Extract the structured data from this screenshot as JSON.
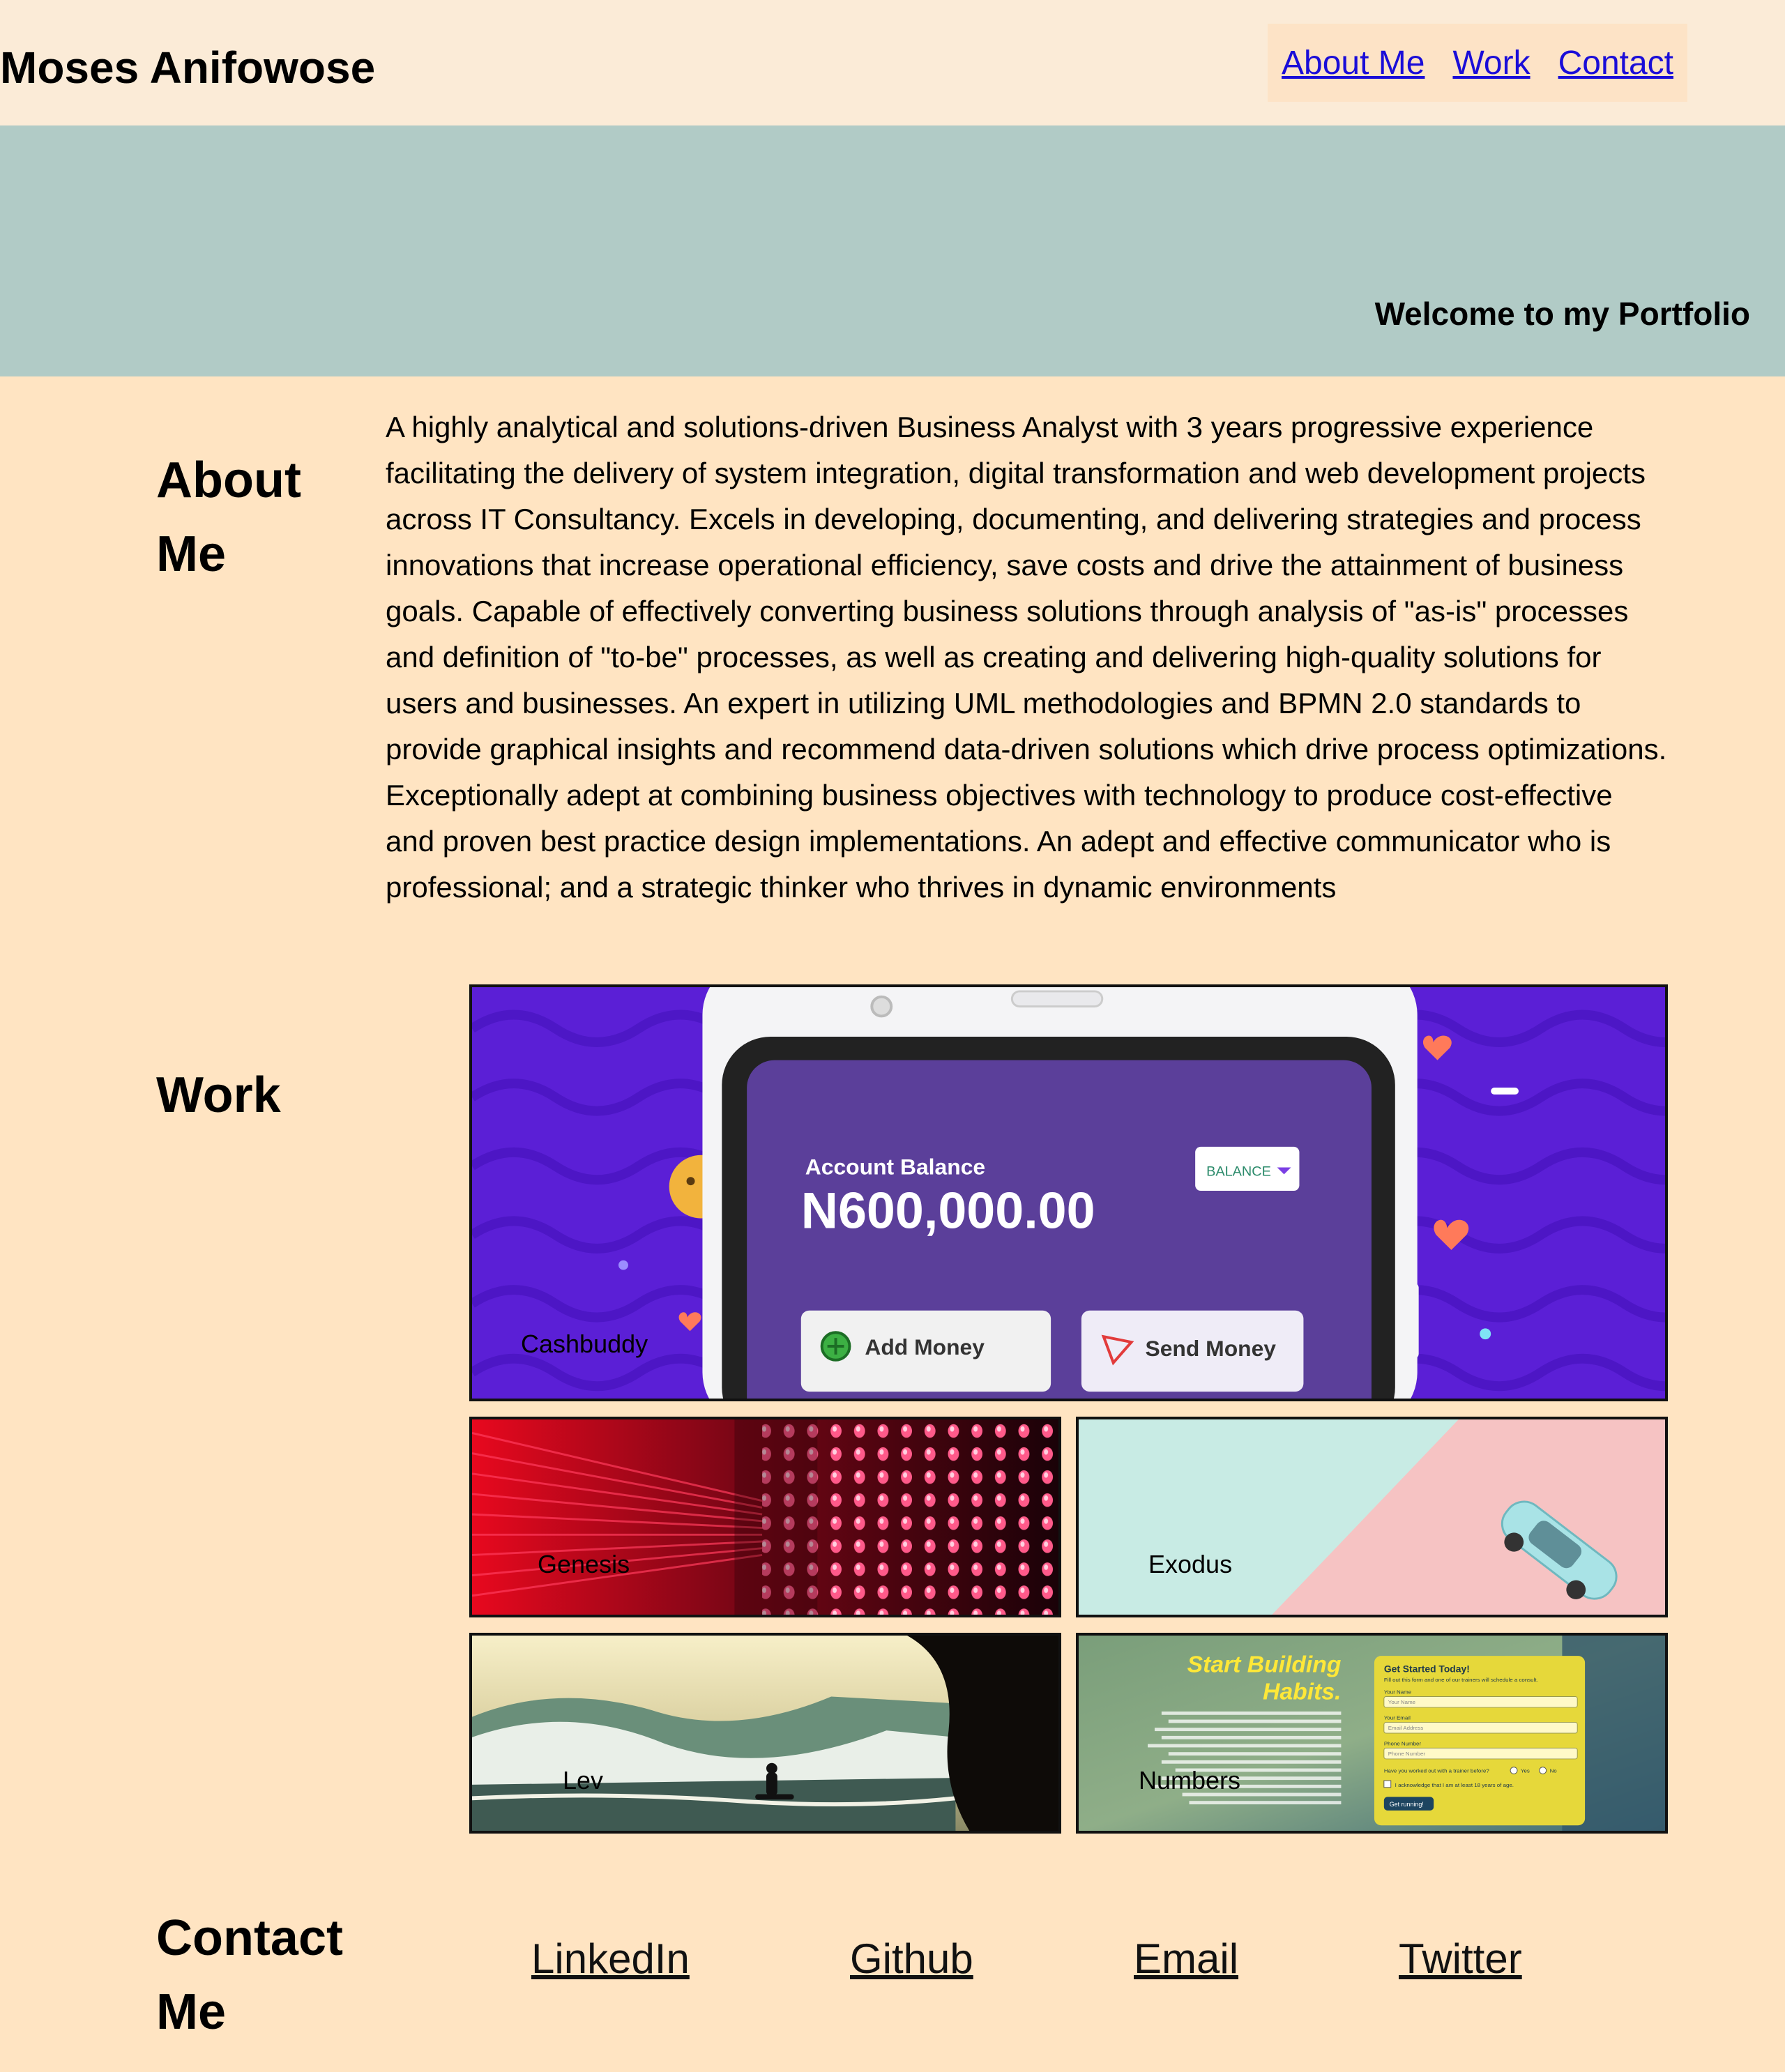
{
  "header": {
    "site_title": "Moses Anifowose",
    "nav": {
      "about": "About Me",
      "work": "Work",
      "contact": "Contact"
    }
  },
  "hero": {
    "welcome": "Welcome to my Portfolio"
  },
  "about": {
    "title_line1": "About",
    "title_line2": "Me",
    "body": "A highly analytical and solutions-driven Business Analyst with 3 years progressive experience facilitating the delivery of system integration, digital transformation and web development projects across IT Consultancy. Excels in developing, documenting, and delivering strategies and process innovations that increase operational efficiency, save costs and drive the attainment of business goals. Capable of effectively converting business solutions through analysis of \"as-is\" processes and definition of \"to-be\" processes, as well as creating and delivering high-quality solutions for users and businesses. An expert in utilizing UML methodologies and BPMN 2.0 standards to provide graphical insights and recommend data-driven solutions which drive process optimizations. Exceptionally adept at combining business objectives with technology to produce cost-effective and proven best practice design implementations. An adept and effective communicator who is professional; and a strategic thinker who thrives in dynamic environments"
  },
  "work": {
    "title": "Work",
    "projects": [
      {
        "label": "Cashbuddy",
        "screen": {
          "account_balance": "Account Balance",
          "amount": "N600,000.00",
          "balance_button": "BALANCE",
          "add_money": "Add Money",
          "send_money": "Send Money"
        }
      },
      {
        "label": "Genesis"
      },
      {
        "label": "Exodus"
      },
      {
        "label": "Lev"
      },
      {
        "label": "Numbers",
        "screen": {
          "headline_1": "Start Building",
          "headline_2": "Habits.",
          "form_title": "Get Started Today!",
          "form_intro": "Fill out this form and one of our trainers will schedule a consult.",
          "name_label": "Your Name",
          "name_placeholder": "Your Name",
          "email_label": "Your Email",
          "email_placeholder": "Email Address",
          "phone_label": "Phone Number",
          "phone_placeholder": "Phone Number",
          "trainer_question": "Have you worked out with a trainer before?",
          "yes": "Yes",
          "no": "No",
          "age_ack": "I acknowledge that I am at least 18 years of age.",
          "submit": "Get running!"
        }
      }
    ]
  },
  "contact": {
    "title_line1": "Contact",
    "title_line2": "Me",
    "links": {
      "linkedin": "LinkedIn",
      "github": "Github",
      "email": "Email",
      "twitter": "Twitter"
    }
  },
  "colors": {
    "header_bg": "#fbebd7",
    "hero_bg": "#b1cbc6",
    "page_bg": "#ffe4c2",
    "nav_bg": "#fde3c6",
    "link_blue": "#1a0dd8"
  }
}
